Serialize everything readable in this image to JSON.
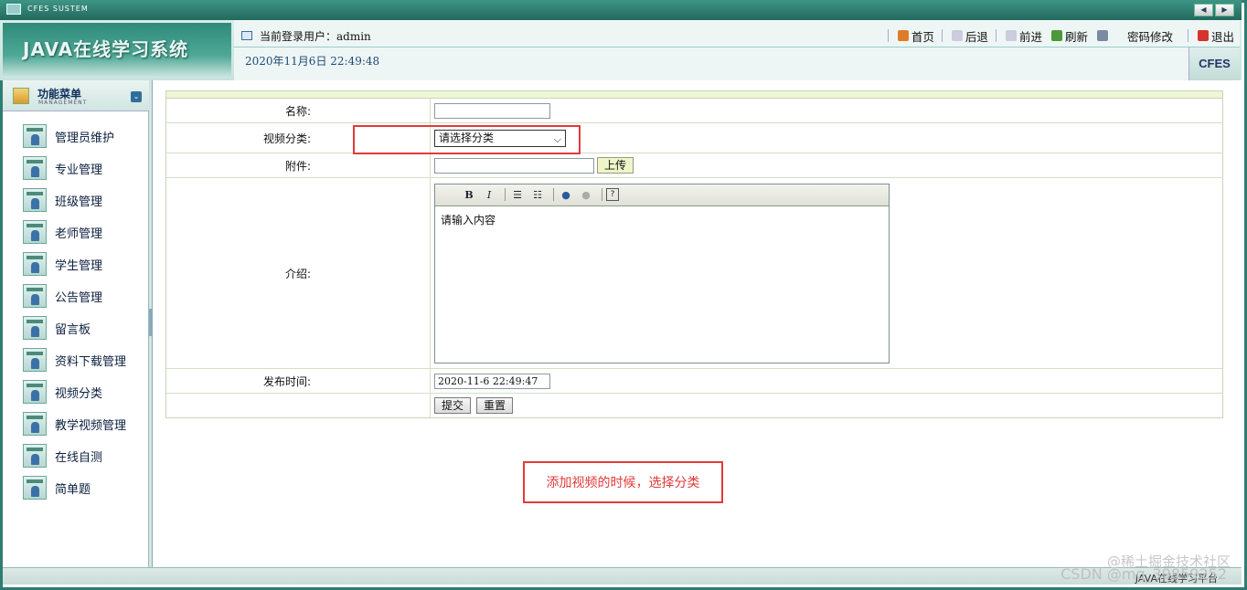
{
  "system_bar": {
    "title": "CFES SUSTEM"
  },
  "header": {
    "logo": "JAVA在线学习系统",
    "current_user_label": "当前登录用户：admin",
    "datetime": "2020年11月6日 22:49:48",
    "links": [
      "首页",
      "后退",
      "前进",
      "刷新",
      "密码修改",
      "退出"
    ],
    "brand": "CFES"
  },
  "sidebar": {
    "title": "功能菜单",
    "subtitle": "MANAGEMENT",
    "items": [
      "管理员维护",
      "专业管理",
      "班级管理",
      "老师管理",
      "学生管理",
      "公告管理",
      "留言板",
      "资料下载管理",
      "视频分类",
      "教学视频管理",
      "在线自测",
      "简单题"
    ]
  },
  "form": {
    "name_label": "名称:",
    "name_value": "",
    "category_label": "视频分类:",
    "category_value": "请选择分类",
    "attachment_label": "附件:",
    "attachment_value": "",
    "upload_button": "上传",
    "intro_label": "介绍:",
    "intro_placeholder": "请输入内容",
    "publish_label": "发布时间:",
    "publish_value": "2020-11-6 22:49:47",
    "submit_button": "提交",
    "reset_button": "重置"
  },
  "annotation": "添加视频的时候，选择分类",
  "footer": {
    "text": "JAVA在线学习平台"
  },
  "watermark": {
    "line1": "@稀土掘金技术社区",
    "line2": "CSDN @mq_39859252"
  },
  "colors": {
    "frame": "#2f7d72",
    "highlight": "#e13a3a"
  }
}
